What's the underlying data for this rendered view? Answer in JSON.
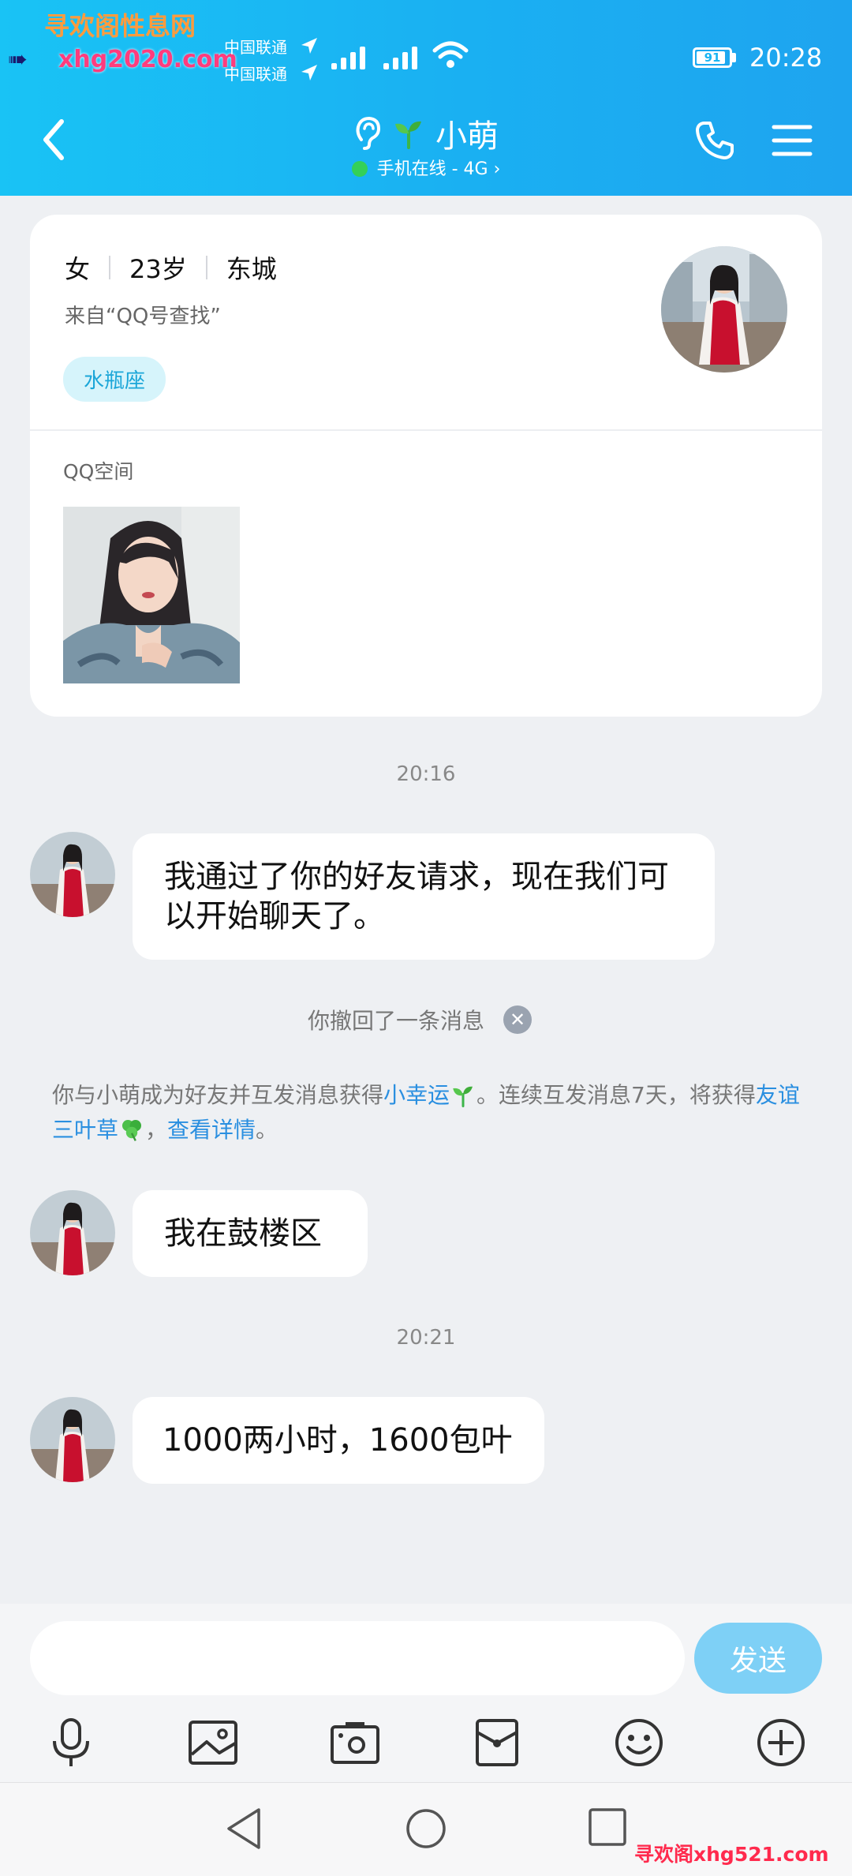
{
  "watermark": {
    "top": "寻欢阁性息网",
    "arrow": "➠",
    "url_top": "xhg2020.com",
    "url_bottom": "寻欢阁xhg521.com"
  },
  "status_bar": {
    "carrier_1": "中国联通",
    "carrier_2": "中国联通",
    "battery": "91",
    "battery_level": 0.91,
    "time": "20:28"
  },
  "header": {
    "contact_name": "小萌",
    "status": "手机在线 - 4G",
    "icons": [
      "back-icon",
      "ear-icon",
      "sprout-icon",
      "phone-icon",
      "menu-icon"
    ]
  },
  "profile_card": {
    "gender": "女",
    "age": "23岁",
    "location": "东城",
    "source": "来自“QQ号查找”",
    "zodiac": "水瓶座",
    "zone_label": "QQ空间"
  },
  "messages": {
    "time_1": "20:16",
    "msg_1": "我通过了你的好友请求，现在我们可以开始聊天了。",
    "recall": "你撤回了一条消息",
    "sys_text_1": "你与小萌成为好友并互发消息获得",
    "sys_link_1": "小幸运",
    "sys_text_2": "。连续互发消息7天，将获得",
    "sys_link_2": "友谊三叶草",
    "sys_text_3": "，",
    "sys_link_3": "查看详情",
    "sys_text_4": "。",
    "msg_2": "我在鼓楼区",
    "time_2": "20:21",
    "msg_3": "1000两小时，1600包叶"
  },
  "input_bar": {
    "placeholder": "",
    "send_label": "发送",
    "tools": [
      "microphone-icon",
      "image-icon",
      "camera-icon",
      "red-packet-icon",
      "emoji-icon",
      "plus-icon"
    ]
  },
  "nav_bar": {
    "buttons": [
      "back-triangle-icon",
      "home-circle-icon",
      "recents-square-icon"
    ]
  },
  "colors": {
    "header": "#1ab4f3",
    "link": "#2a8fe0",
    "send": "#7ed0f6",
    "zodiac_bg": "#d6f4fb"
  }
}
